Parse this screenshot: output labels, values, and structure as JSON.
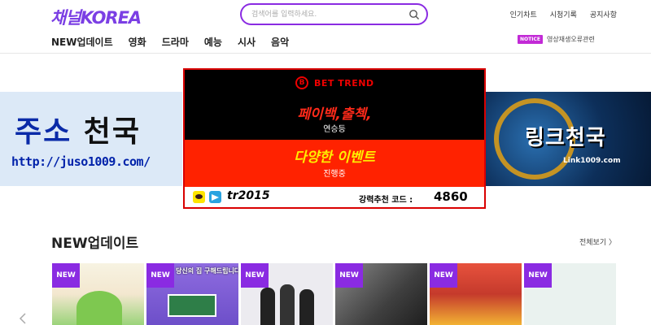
{
  "header": {
    "logo": "채널KOREA",
    "search_placeholder": "검색어를 입력하세요.",
    "top_links": [
      "인기차트",
      "시청기록",
      "공지사항"
    ],
    "nav": [
      "NEW업데이트",
      "영화",
      "드라마",
      "예능",
      "시사",
      "음악"
    ],
    "notice_badge": "NOTICE",
    "notice_text": "영상재생오류관련"
  },
  "banners": {
    "left": {
      "title_part1": "주소",
      "title_part2": "천국",
      "url": "http://juso1009.com/"
    },
    "center": {
      "brand": "BET TREND",
      "line1": "페이백,출첵,",
      "sub1": "연승등",
      "line2": "다양한 이벤트",
      "sub2": "진행중",
      "contact_id": "tr2015",
      "code_label": "강력추천 코드 :",
      "code": "4860"
    },
    "right": {
      "title": "링크천국",
      "sub": "Link1009.com"
    }
  },
  "section": {
    "title": "NEW업데이트",
    "view_all": "전체보기 〉",
    "new_badge": "NEW",
    "thumbnails": [
      {
        "caption": "",
        "bg": "#f3e7cf"
      },
      {
        "caption": "당신의 집 구해드립니다",
        "bg": "#7b5bd6"
      },
      {
        "caption": "",
        "bg": "#e9e7ee"
      },
      {
        "caption": "",
        "bg": "#5a5a5a"
      },
      {
        "caption": "",
        "bg": "#c53a2c"
      },
      {
        "caption": "",
        "bg": "#e9f1ef"
      }
    ]
  },
  "colors": {
    "accent": "#8a2be2",
    "logo": "#7b3fe4",
    "banner_red": "#ff2200"
  }
}
